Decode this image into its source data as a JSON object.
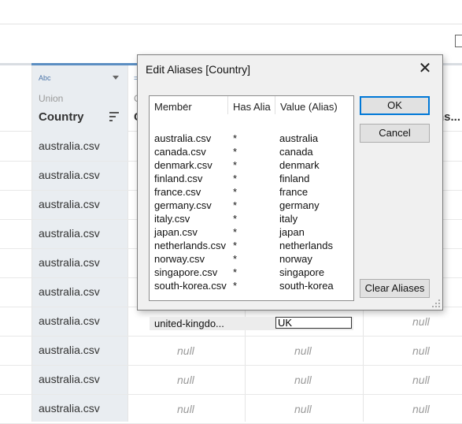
{
  "dialog": {
    "title": "Edit Aliases [Country]",
    "columns": {
      "member": "Member",
      "has_alias": "Has Alia",
      "value": "Value (Alias)"
    },
    "rows": [
      {
        "member": "australia.csv",
        "has_alias": "*",
        "value": "australia"
      },
      {
        "member": "canada.csv",
        "has_alias": "*",
        "value": "canada"
      },
      {
        "member": "denmark.csv",
        "has_alias": "*",
        "value": "denmark"
      },
      {
        "member": "finland.csv",
        "has_alias": "*",
        "value": "finland"
      },
      {
        "member": "france.csv",
        "has_alias": "*",
        "value": "france"
      },
      {
        "member": "germany.csv",
        "has_alias": "*",
        "value": "germany"
      },
      {
        "member": "italy.csv",
        "has_alias": "*",
        "value": "italy"
      },
      {
        "member": "japan.csv",
        "has_alias": "*",
        "value": "japan"
      },
      {
        "member": "netherlands.csv",
        "has_alias": "*",
        "value": "netherlands"
      },
      {
        "member": "norway.csv",
        "has_alias": "*",
        "value": "norway"
      },
      {
        "member": "singapore.csv",
        "has_alias": "*",
        "value": "singapore"
      },
      {
        "member": "south-korea.csv",
        "has_alias": "*",
        "value": "south-korea"
      }
    ],
    "editing_row": {
      "member": "united-kingdo...",
      "input_value": "UK"
    },
    "buttons": {
      "ok": "OK",
      "cancel": "Cancel",
      "clear": "Clear Aliases"
    }
  },
  "grid": {
    "type_label": "Abc",
    "type_label2": "=",
    "source_label": "Union",
    "source_label2": "C",
    "field_label": "Country",
    "field_label2": "C",
    "field_label3": "ns...",
    "cell_value": "australia.csv",
    "null_text": "null"
  }
}
